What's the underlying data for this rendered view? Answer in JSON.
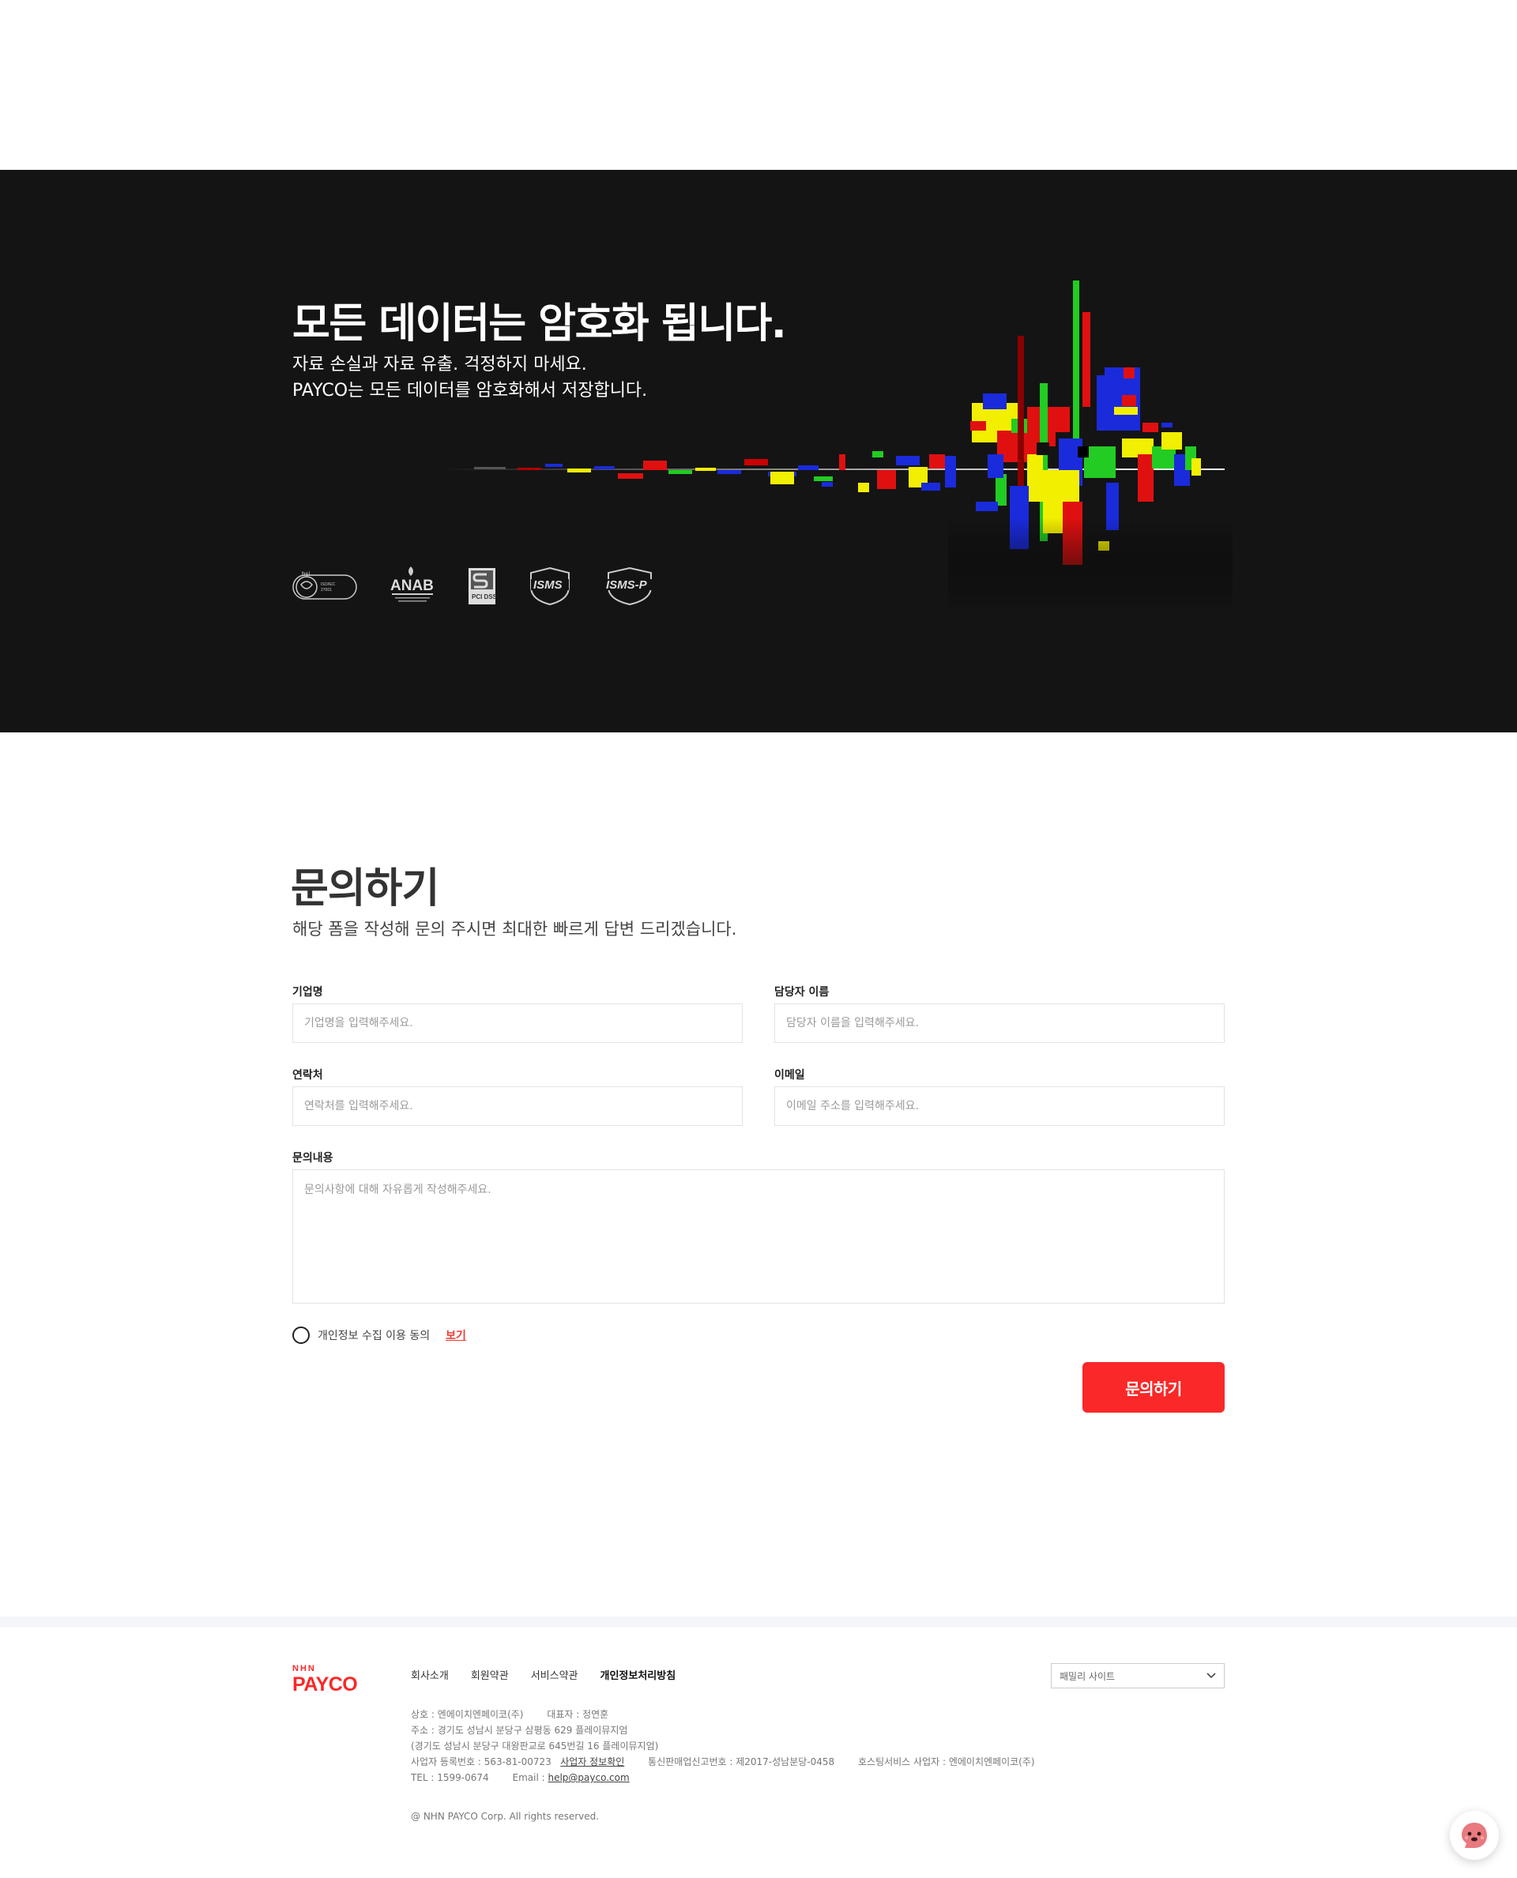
{
  "hero": {
    "title": "모든 데이터는 암호화 됩니다.",
    "subtitle_line1": "자료 손실과 자료 유출. 걱정하지 마세요.",
    "subtitle_line2": "PAYCO는 모든 데이터를 암호화해서 저장합니다.",
    "certifications": [
      "bsi ISO/IEC 27001",
      "ANAB",
      "PCI DSS",
      "ISMS",
      "ISMS-P"
    ]
  },
  "inquiry": {
    "title": "문의하기",
    "description": "해당 폼을 작성해 문의 주시면 최대한 빠르게 답변 드리겠습니다.",
    "fields": {
      "company": {
        "label": "기업명",
        "placeholder": "기업명을 입력해주세요.",
        "value": ""
      },
      "manager": {
        "label": "담당자 이름",
        "placeholder": "담당자 이름을 입력해주세요.",
        "value": ""
      },
      "phone": {
        "label": "연락처",
        "placeholder": "연락처를 입력해주세요.",
        "value": ""
      },
      "email": {
        "label": "이메일",
        "placeholder": "이메일 주소를 입력해주세요.",
        "value": ""
      },
      "content": {
        "label": "문의내용",
        "placeholder": "문의사항에 대해 자유롭게 작성해주세요.",
        "value": ""
      }
    },
    "agree_label": "개인정보 수집 이용 동의",
    "agree_link": "보기",
    "agree_checked": false,
    "submit_label": "문의하기"
  },
  "footer": {
    "logo_top": "NHN",
    "logo_main": "PAYCO",
    "nav": [
      "회사소개",
      "회원약관",
      "서비스약관",
      "개인정보처리방침"
    ],
    "family_site": "패밀리 사이트",
    "info": {
      "company": "상호 : 엔에이치엔페이코(주)",
      "ceo": "대표자 : 정연훈",
      "address": "주소 : 경기도 성남시 분당구 삼평동 629 플레이뮤지엄",
      "address_road": "(경기도 성남시 분당구 대왕판교로 645번길 16 플레이뮤지엄)",
      "biz_no": "사업자 등록번호 : 563-81-00723",
      "biz_link": "사업자 정보확인",
      "mail_order": "통신판매업신고번호 : 제2017-성남분당-0458",
      "hosting": "호스팅서비스 사업자 : 엔에이치엔페이코(주)",
      "tel": "TEL : 1599-0674",
      "email_label": "Email : ",
      "email": "help@payco.com"
    },
    "copyright": "@ NHN PAYCO Corp. All rights reserved."
  },
  "colors": {
    "accent": "#fa2828",
    "hero_bg": "#141414",
    "footer_band": "#f4f6f9"
  }
}
